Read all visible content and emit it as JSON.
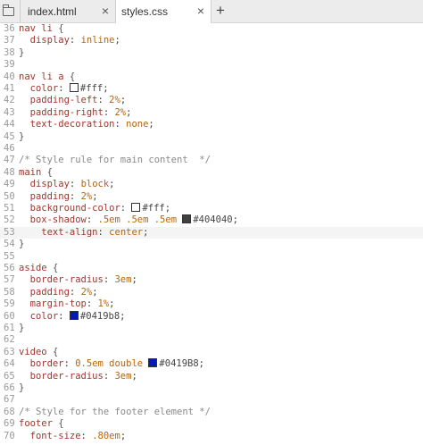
{
  "tabs": [
    {
      "label": "index.html",
      "close": "×"
    },
    {
      "label": "styles.css",
      "close": "×"
    }
  ],
  "add_tab": "+",
  "colors": {
    "white": "#ffffff",
    "dark": "#404040",
    "blue": "#0419b8"
  },
  "lines": [
    {
      "n": "36",
      "seg": [
        {
          "c": "sel",
          "t": "nav li "
        },
        {
          "c": "br",
          "t": "{"
        }
      ]
    },
    {
      "n": "37",
      "seg": [
        {
          "c": "prop",
          "t": "  display"
        },
        {
          "c": "txt",
          "t": ": "
        },
        {
          "c": "val",
          "t": "inline"
        },
        {
          "c": "txt",
          "t": ";"
        }
      ]
    },
    {
      "n": "38",
      "seg": [
        {
          "c": "br",
          "t": "}"
        }
      ]
    },
    {
      "n": "39",
      "seg": []
    },
    {
      "n": "40",
      "seg": [
        {
          "c": "sel",
          "t": "nav li a "
        },
        {
          "c": "br",
          "t": "{"
        }
      ]
    },
    {
      "n": "41",
      "seg": [
        {
          "c": "prop",
          "t": "  color"
        },
        {
          "c": "txt",
          "t": ": "
        },
        {
          "sw": "white"
        },
        {
          "c": "txt",
          "t": "#fff;"
        }
      ]
    },
    {
      "n": "42",
      "seg": [
        {
          "c": "prop",
          "t": "  padding-left"
        },
        {
          "c": "txt",
          "t": ": "
        },
        {
          "c": "val",
          "t": "2%"
        },
        {
          "c": "txt",
          "t": ";"
        }
      ]
    },
    {
      "n": "43",
      "seg": [
        {
          "c": "prop",
          "t": "  padding-right"
        },
        {
          "c": "txt",
          "t": ": "
        },
        {
          "c": "val",
          "t": "2%"
        },
        {
          "c": "txt",
          "t": ";"
        }
      ]
    },
    {
      "n": "44",
      "seg": [
        {
          "c": "prop",
          "t": "  text-decoration"
        },
        {
          "c": "txt",
          "t": ": "
        },
        {
          "c": "val",
          "t": "none"
        },
        {
          "c": "txt",
          "t": ";"
        }
      ]
    },
    {
      "n": "45",
      "seg": [
        {
          "c": "br",
          "t": "}"
        }
      ]
    },
    {
      "n": "46",
      "seg": []
    },
    {
      "n": "47",
      "seg": [
        {
          "c": "cmt",
          "t": "/* Style rule for main content  */"
        }
      ]
    },
    {
      "n": "48",
      "seg": [
        {
          "c": "sel",
          "t": "main "
        },
        {
          "c": "br",
          "t": "{"
        }
      ]
    },
    {
      "n": "49",
      "seg": [
        {
          "c": "prop",
          "t": "  display"
        },
        {
          "c": "txt",
          "t": ": "
        },
        {
          "c": "val",
          "t": "block"
        },
        {
          "c": "txt",
          "t": ";"
        }
      ]
    },
    {
      "n": "50",
      "seg": [
        {
          "c": "prop",
          "t": "  padding"
        },
        {
          "c": "txt",
          "t": ": "
        },
        {
          "c": "val",
          "t": "2%"
        },
        {
          "c": "txt",
          "t": ";"
        }
      ]
    },
    {
      "n": "51",
      "seg": [
        {
          "c": "prop",
          "t": "  background-color"
        },
        {
          "c": "txt",
          "t": ": "
        },
        {
          "sw": "white"
        },
        {
          "c": "txt",
          "t": "#fff;"
        }
      ]
    },
    {
      "n": "52",
      "seg": [
        {
          "c": "prop",
          "t": "  box-shadow"
        },
        {
          "c": "txt",
          "t": ": "
        },
        {
          "c": "val",
          "t": ".5em .5em .5em "
        },
        {
          "sw": "dark"
        },
        {
          "c": "txt",
          "t": "#404040;"
        }
      ]
    },
    {
      "n": "53",
      "current": true,
      "seg": [
        {
          "c": "prop",
          "t": "    text-align"
        },
        {
          "c": "txt",
          "t": ": "
        },
        {
          "c": "val",
          "t": "center"
        },
        {
          "c": "txt",
          "t": ";"
        }
      ]
    },
    {
      "n": "54",
      "seg": [
        {
          "c": "br",
          "t": "}"
        }
      ]
    },
    {
      "n": "55",
      "seg": []
    },
    {
      "n": "56",
      "seg": [
        {
          "c": "sel",
          "t": "aside "
        },
        {
          "c": "br",
          "t": "{"
        }
      ]
    },
    {
      "n": "57",
      "seg": [
        {
          "c": "prop",
          "t": "  border-radius"
        },
        {
          "c": "txt",
          "t": ": "
        },
        {
          "c": "val",
          "t": "3em"
        },
        {
          "c": "txt",
          "t": ";"
        }
      ]
    },
    {
      "n": "58",
      "seg": [
        {
          "c": "prop",
          "t": "  padding"
        },
        {
          "c": "txt",
          "t": ": "
        },
        {
          "c": "val",
          "t": "2%"
        },
        {
          "c": "txt",
          "t": ";"
        }
      ]
    },
    {
      "n": "59",
      "seg": [
        {
          "c": "prop",
          "t": "  margin-top"
        },
        {
          "c": "txt",
          "t": ": "
        },
        {
          "c": "val",
          "t": "1%"
        },
        {
          "c": "txt",
          "t": ";"
        }
      ]
    },
    {
      "n": "60",
      "seg": [
        {
          "c": "prop",
          "t": "  color"
        },
        {
          "c": "txt",
          "t": ": "
        },
        {
          "sw": "blue"
        },
        {
          "c": "txt",
          "t": "#0419b8;"
        }
      ]
    },
    {
      "n": "61",
      "seg": [
        {
          "c": "br",
          "t": "}"
        }
      ]
    },
    {
      "n": "62",
      "seg": []
    },
    {
      "n": "63",
      "seg": [
        {
          "c": "sel",
          "t": "video "
        },
        {
          "c": "br",
          "t": "{"
        }
      ]
    },
    {
      "n": "64",
      "seg": [
        {
          "c": "prop",
          "t": "  border"
        },
        {
          "c": "txt",
          "t": ": "
        },
        {
          "c": "val",
          "t": "0.5em double "
        },
        {
          "sw": "blue"
        },
        {
          "c": "txt",
          "t": "#0419B8;"
        }
      ]
    },
    {
      "n": "65",
      "seg": [
        {
          "c": "prop",
          "t": "  border-radius"
        },
        {
          "c": "txt",
          "t": ": "
        },
        {
          "c": "val",
          "t": "3em"
        },
        {
          "c": "txt",
          "t": ";"
        }
      ]
    },
    {
      "n": "66",
      "seg": [
        {
          "c": "br",
          "t": "}"
        }
      ]
    },
    {
      "n": "67",
      "seg": []
    },
    {
      "n": "68",
      "seg": [
        {
          "c": "cmt",
          "t": "/* Style for the footer element */"
        }
      ]
    },
    {
      "n": "69",
      "seg": [
        {
          "c": "sel",
          "t": "footer "
        },
        {
          "c": "br",
          "t": "{"
        }
      ]
    },
    {
      "n": "70",
      "seg": [
        {
          "c": "prop",
          "t": "  font-size"
        },
        {
          "c": "txt",
          "t": ": "
        },
        {
          "c": "val",
          "t": ".80em"
        },
        {
          "c": "txt",
          "t": ";"
        }
      ]
    }
  ]
}
